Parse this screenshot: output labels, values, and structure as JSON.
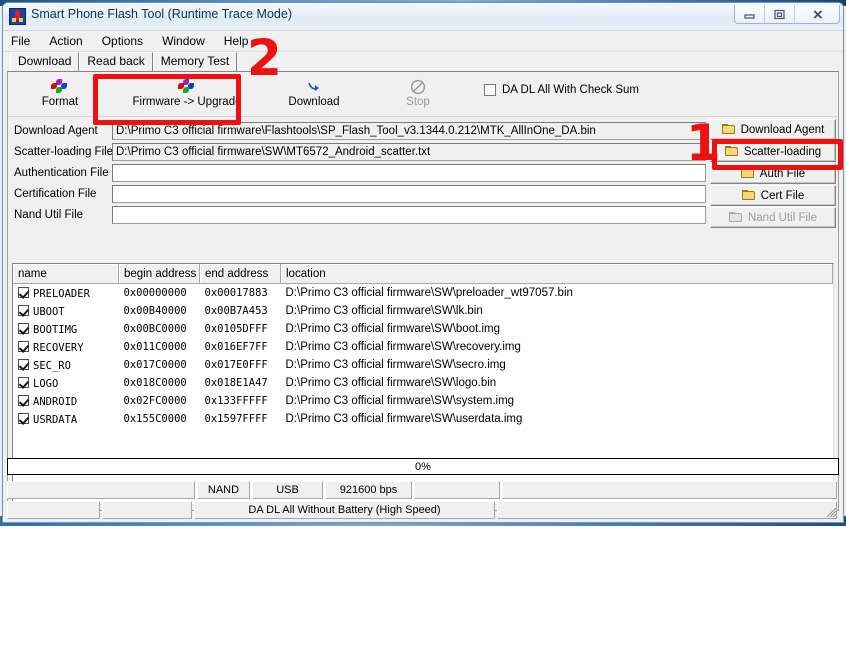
{
  "window": {
    "title": "Smart Phone Flash Tool (Runtime Trace Mode)",
    "app_icon": "flash-tool-icon",
    "controls": {
      "minimize": "minimize-icon",
      "maximize": "maximize-icon",
      "close": "close-icon"
    }
  },
  "menu": {
    "items": [
      {
        "label": "File"
      },
      {
        "label": "Action"
      },
      {
        "label": "Options"
      },
      {
        "label": "Window"
      },
      {
        "label": "Help"
      }
    ]
  },
  "tabs": [
    {
      "label": "Download",
      "active": true
    },
    {
      "label": "Read back",
      "active": false
    },
    {
      "label": "Memory Test",
      "active": false
    }
  ],
  "toolbar": {
    "buttons": [
      {
        "label": "Format",
        "icon": "pinwheel-icon",
        "enabled": true
      },
      {
        "label": "Firmware -> Upgrade",
        "icon": "pinwheel-icon",
        "enabled": true
      },
      {
        "label": "Download",
        "icon": "download-arrow-icon",
        "enabled": true
      },
      {
        "label": "Stop",
        "icon": "stop-circle-icon",
        "enabled": false
      }
    ],
    "checkbox": {
      "label": "DA DL All With Check Sum",
      "checked": false
    }
  },
  "file_fields": [
    {
      "label": "Download Agent",
      "value": "D:\\Primo C3 official firmware\\Flashtools\\SP_Flash_Tool_v3.1344.0.212\\MTK_AllInOne_DA.bin",
      "readonly": true
    },
    {
      "label": "Scatter-loading File",
      "value": "D:\\Primo C3 official firmware\\SW\\MT6572_Android_scatter.txt",
      "readonly": false
    },
    {
      "label": "Authentication File",
      "value": "",
      "readonly": false
    },
    {
      "label": "Certification File",
      "value": "",
      "readonly": false
    },
    {
      "label": "Nand Util File",
      "value": "",
      "readonly": false
    }
  ],
  "browse_buttons": [
    {
      "label": "Download Agent",
      "icon": "folder-icon",
      "enabled": true
    },
    {
      "label": "Scatter-loading",
      "icon": "folder-icon",
      "enabled": true
    },
    {
      "label": "Auth File",
      "icon": "folder-icon",
      "enabled": true
    },
    {
      "label": "Cert File",
      "icon": "folder-icon",
      "enabled": true
    },
    {
      "label": "Nand Util File",
      "icon": "folder-icon",
      "enabled": false
    }
  ],
  "grid": {
    "columns": [
      "name",
      "begin address",
      "end address",
      "location"
    ],
    "rows": [
      {
        "checked": true,
        "name": "PRELOADER",
        "begin": "0x00000000",
        "end": "0x00017883",
        "location": "D:\\Primo C3 official firmware\\SW\\preloader_wt97057.bin"
      },
      {
        "checked": true,
        "name": "UBOOT",
        "begin": "0x00B40000",
        "end": "0x00B7A453",
        "location": "D:\\Primo C3 official firmware\\SW\\lk.bin"
      },
      {
        "checked": true,
        "name": "BOOTIMG",
        "begin": "0x00BC0000",
        "end": "0x0105DFFF",
        "location": "D:\\Primo C3 official firmware\\SW\\boot.img"
      },
      {
        "checked": true,
        "name": "RECOVERY",
        "begin": "0x011C0000",
        "end": "0x016EF7FF",
        "location": "D:\\Primo C3 official firmware\\SW\\recovery.img"
      },
      {
        "checked": true,
        "name": "SEC_RO",
        "begin": "0x017C0000",
        "end": "0x017E0FFF",
        "location": "D:\\Primo C3 official firmware\\SW\\secro.img"
      },
      {
        "checked": true,
        "name": "LOGO",
        "begin": "0x018C0000",
        "end": "0x018E1A47",
        "location": "D:\\Primo C3 official firmware\\SW\\logo.bin"
      },
      {
        "checked": true,
        "name": "ANDROID",
        "begin": "0x02FC0000",
        "end": "0x133FFFFF",
        "location": "D:\\Primo C3 official firmware\\SW\\system.img"
      },
      {
        "checked": true,
        "name": "USRDATA",
        "begin": "0x155C0000",
        "end": "0x1597FFFF",
        "location": "D:\\Primo C3 official firmware\\SW\\userdata.img"
      }
    ]
  },
  "progress": {
    "text": "0%",
    "percent": 0
  },
  "status": {
    "row1": [
      "",
      "NAND",
      "USB",
      "921600 bps",
      "",
      ""
    ],
    "row2": [
      "",
      "",
      "DA DL All Without Battery (High Speed)",
      ""
    ]
  },
  "annotations": [
    {
      "label": "1",
      "target": "scatter-loading-button"
    },
    {
      "label": "2",
      "target": "firmware-upgrade-button"
    }
  ],
  "colors": {
    "annotation_red": "#ee1111",
    "window_chrome": "#f0f0f0",
    "title_text": "#10305a"
  }
}
